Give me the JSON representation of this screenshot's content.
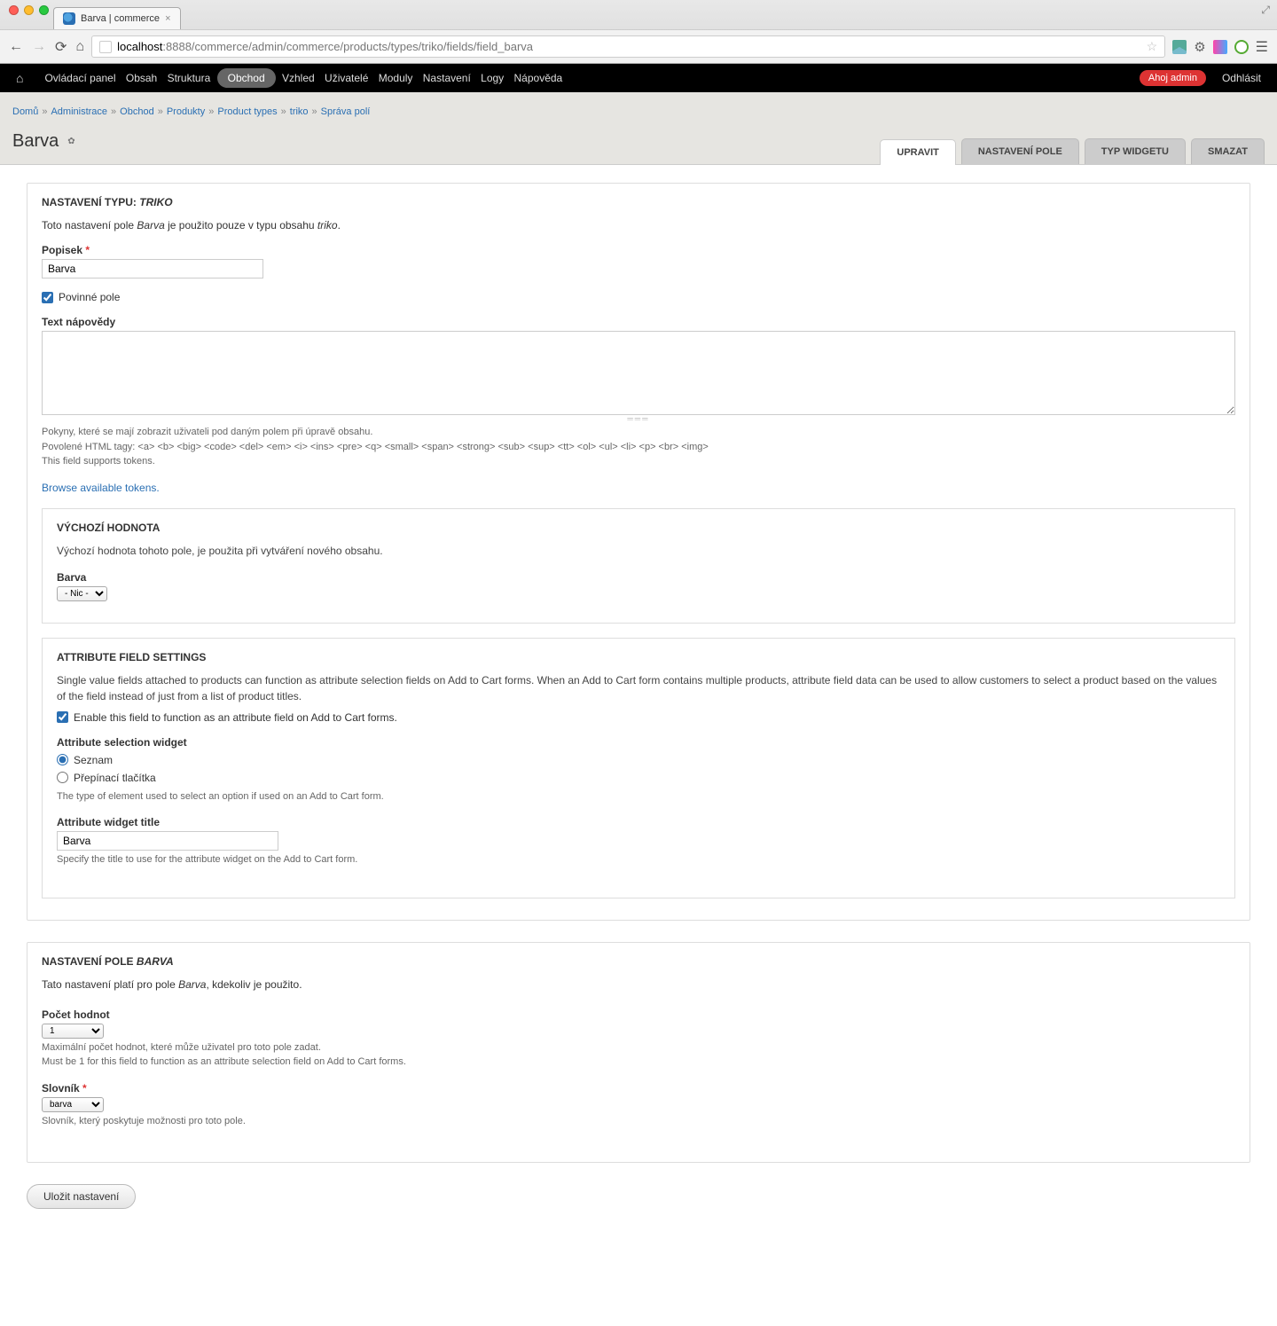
{
  "browser": {
    "tab_title": "Barva | commerce",
    "url_host": "localhost",
    "url_port_path": ":8888/commerce/admin/commerce/products/types/triko/fields/field_barva"
  },
  "toolbar": {
    "items": [
      "Ovládací panel",
      "Obsah",
      "Struktura",
      "Obchod",
      "Vzhled",
      "Uživatelé",
      "Moduly",
      "Nastavení",
      "Logy",
      "Nápověda"
    ],
    "active_index": 3,
    "hello": "Ahoj admin",
    "logout": "Odhlásit"
  },
  "breadcrumb": {
    "items": [
      "Domů",
      "Administrace",
      "Obchod",
      "Produkty",
      "Product types",
      "triko",
      "Správa polí"
    ]
  },
  "page": {
    "title": "Barva",
    "tabs": [
      "UPRAVIT",
      "NASTAVENÍ POLE",
      "TYP WIDGETU",
      "SMAZAT"
    ],
    "active_tab": 0
  },
  "form": {
    "type_settings_heading_prefix": "NASTAVENÍ TYPU: ",
    "type_settings_heading_em": "TRIKO",
    "type_settings_desc_pre": "Toto nastavení pole ",
    "type_settings_desc_em1": "Barva",
    "type_settings_desc_mid": " je použito pouze v typu obsahu ",
    "type_settings_desc_em2": "triko",
    "label_label": "Popisek",
    "label_value": "Barva",
    "required_label": "Povinné pole",
    "required_checked": true,
    "help_label": "Text nápovědy",
    "help_value": "",
    "help_desc1": "Pokyny, které se mají zobrazit uživateli pod daným polem při úpravě obsahu.",
    "help_desc2": "Povolené HTML tagy: <a> <b> <big> <code> <del> <em> <i> <ins> <pre> <q> <small> <span> <strong> <sub> <sup> <tt> <ol> <ul> <li> <p> <br> <img>",
    "help_desc3": "This field supports tokens.",
    "tokens_link": "Browse available tokens.",
    "default_heading": "VÝCHOZÍ HODNOTA",
    "default_desc": "Výchozí hodnota tohoto pole, je použita při vytváření nového obsahu.",
    "default_field_label": "Barva",
    "default_select": "- Nic -",
    "attr_heading": "ATTRIBUTE FIELD SETTINGS",
    "attr_desc": "Single value fields attached to products can function as attribute selection fields on Add to Cart forms. When an Add to Cart form contains multiple products, attribute field data can be used to allow customers to select a product based on the values of the field instead of just from a list of product titles.",
    "attr_enable_label": "Enable this field to function as an attribute field on Add to Cart forms.",
    "attr_enable_checked": true,
    "attr_widget_label": "Attribute selection widget",
    "attr_widget_opt1": "Seznam",
    "attr_widget_opt2": "Přepínací tlačítka",
    "attr_widget_desc": "The type of element used to select an option if used on an Add to Cart form.",
    "attr_title_label": "Attribute widget title",
    "attr_title_value": "Barva",
    "attr_title_desc": "Specify the title to use for the attribute widget on the Add to Cart form.",
    "field_settings_heading_prefix": "NASTAVENÍ POLE ",
    "field_settings_heading_em": "BARVA",
    "field_settings_desc_pre": "Tato nastavení platí pro pole ",
    "field_settings_desc_em": "Barva",
    "field_settings_desc_post": ", kdekoliv je použito.",
    "values_label": "Počet hodnot",
    "values_value": "1",
    "values_desc1": "Maximální počet hodnot, které může uživatel pro toto pole zadat.",
    "values_desc2": "Must be 1 for this field to function as an attribute selection field on Add to Cart forms.",
    "vocab_label": "Slovník",
    "vocab_value": "barva",
    "vocab_desc": "Slovník, který poskytuje možnosti pro toto pole.",
    "submit": "Uložit nastavení"
  }
}
